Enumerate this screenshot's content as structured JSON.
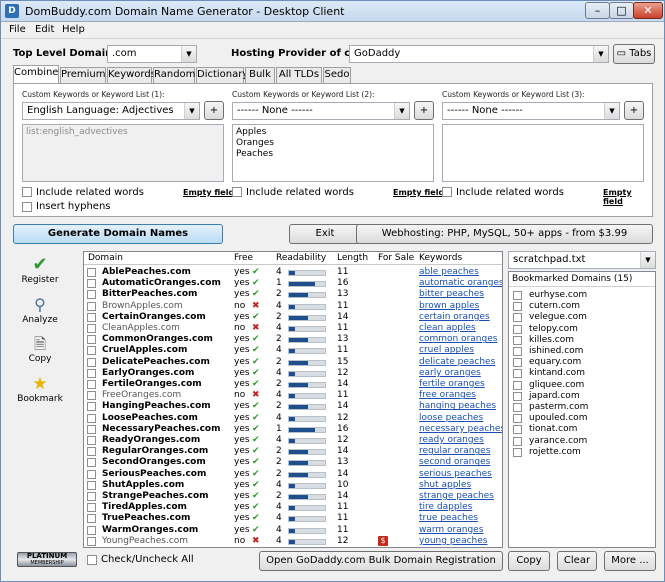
{
  "window": {
    "title": "DomBuddy.com Domain Name Generator - Desktop Client",
    "min": "–",
    "max": "□",
    "close": "✕"
  },
  "menu": [
    "File",
    "Edit",
    "Help"
  ],
  "top": {
    "tld_label": "Top Level Domain:",
    "tld_value": ".com",
    "hosting_label": "Hosting Provider of choice:",
    "hosting_value": "GoDaddy",
    "tabs_button": "Tabs"
  },
  "tabs": [
    "Combine",
    "Premium",
    "Keywords",
    "Random",
    "Dictionary",
    "Bulk",
    "All TLDs",
    "Sedo"
  ],
  "combine": {
    "col1": {
      "header": "Custom Keywords or Keyword List (1):",
      "select": "English Language: Adjectives",
      "list_text": "list:english_advectives",
      "include_related": "Include related words",
      "empty_field": "Empty field",
      "insert_hyphens": "Insert hyphens"
    },
    "col2": {
      "header": "Custom Keywords or Keyword List (2):",
      "select": "------ None ------",
      "lines": [
        "Apples",
        "Oranges",
        "Peaches"
      ],
      "include_related": "Include related words",
      "empty_field": "Empty field"
    },
    "col3": {
      "header": "Custom Keywords or Keyword List (3):",
      "select": "------ None ------",
      "include_related": "Include related words",
      "empty_field": "Empty field"
    },
    "add": "+"
  },
  "actions": {
    "generate": "Generate Domain Names",
    "exit": "Exit",
    "webhosting": "Webhosting: PHP, MySQL, 50+ apps - from $3.99"
  },
  "side": {
    "register": "Register",
    "analyze": "Analyze",
    "copy": "Copy",
    "bookmark": "Bookmark"
  },
  "grid": {
    "headers": {
      "domain": "Domain",
      "free": "Free",
      "readability": "Readability",
      "length": "Length",
      "forsale": "For Sale",
      "keywords": "Keywords"
    },
    "rows": [
      {
        "domain": "AblePeaches.com",
        "free": "yes",
        "read": 4,
        "length": 11,
        "forsale": "",
        "kw": "able peaches"
      },
      {
        "domain": "AutomaticOranges.com",
        "free": "yes",
        "read": 1,
        "length": 16,
        "forsale": "",
        "kw": "automatic oranges"
      },
      {
        "domain": "BitterPeaches.com",
        "free": "yes",
        "read": 2,
        "length": 13,
        "forsale": "",
        "kw": "bitter peaches"
      },
      {
        "domain": "BrownApples.com",
        "free": "no",
        "read": 4,
        "length": 11,
        "forsale": "",
        "kw": "brown apples"
      },
      {
        "domain": "CertainOranges.com",
        "free": "yes",
        "read": 2,
        "length": 14,
        "forsale": "",
        "kw": "certain oranges"
      },
      {
        "domain": "CleanApples.com",
        "free": "no",
        "read": 4,
        "length": 11,
        "forsale": "",
        "kw": "clean apples"
      },
      {
        "domain": "CommonOranges.com",
        "free": "yes",
        "read": 2,
        "length": 13,
        "forsale": "",
        "kw": "common oranges"
      },
      {
        "domain": "CruelApples.com",
        "free": "yes",
        "read": 4,
        "length": 11,
        "forsale": "",
        "kw": "cruel apples"
      },
      {
        "domain": "DelicatePeaches.com",
        "free": "yes",
        "read": 2,
        "length": 15,
        "forsale": "",
        "kw": "delicate peaches"
      },
      {
        "domain": "EarlyOranges.com",
        "free": "yes",
        "read": 4,
        "length": 12,
        "forsale": "",
        "kw": "early oranges"
      },
      {
        "domain": "FertileOranges.com",
        "free": "yes",
        "read": 2,
        "length": 14,
        "forsale": "",
        "kw": "fertile oranges"
      },
      {
        "domain": "FreeOranges.com",
        "free": "no",
        "read": 4,
        "length": 11,
        "forsale": "",
        "kw": "free oranges"
      },
      {
        "domain": "HangingPeaches.com",
        "free": "yes",
        "read": 2,
        "length": 14,
        "forsale": "",
        "kw": "hanging peaches"
      },
      {
        "domain": "LoosePeaches.com",
        "free": "yes",
        "read": 4,
        "length": 12,
        "forsale": "",
        "kw": "loose peaches"
      },
      {
        "domain": "NecessaryPeaches.com",
        "free": "yes",
        "read": 1,
        "length": 16,
        "forsale": "",
        "kw": "necessary peaches"
      },
      {
        "domain": "ReadyOranges.com",
        "free": "yes",
        "read": 4,
        "length": 12,
        "forsale": "",
        "kw": "ready oranges"
      },
      {
        "domain": "RegularOranges.com",
        "free": "yes",
        "read": 2,
        "length": 14,
        "forsale": "",
        "kw": "regular oranges"
      },
      {
        "domain": "SecondOranges.com",
        "free": "yes",
        "read": 2,
        "length": 13,
        "forsale": "",
        "kw": "second oranges"
      },
      {
        "domain": "SeriousPeaches.com",
        "free": "yes",
        "read": 2,
        "length": 14,
        "forsale": "",
        "kw": "serious peaches"
      },
      {
        "domain": "ShutApples.com",
        "free": "yes",
        "read": 4,
        "length": 10,
        "forsale": "",
        "kw": "shut apples"
      },
      {
        "domain": "StrangePeaches.com",
        "free": "yes",
        "read": 2,
        "length": 14,
        "forsale": "",
        "kw": "strange peaches"
      },
      {
        "domain": "TiredApples.com",
        "free": "yes",
        "read": 4,
        "length": 11,
        "forsale": "",
        "kw": "tire dapples"
      },
      {
        "domain": "TruePeaches.com",
        "free": "yes",
        "read": 4,
        "length": 11,
        "forsale": "",
        "kw": "true peaches"
      },
      {
        "domain": "WarmOranges.com",
        "free": "yes",
        "read": 4,
        "length": 11,
        "forsale": "",
        "kw": "warm oranges"
      },
      {
        "domain": "YoungPeaches.com",
        "free": "no",
        "read": 4,
        "length": 12,
        "forsale": "$",
        "kw": "young peaches"
      }
    ]
  },
  "checkall": "Check/Uncheck All",
  "bulk_button": "Open GoDaddy.com Bulk Domain Registration",
  "scratchpad": {
    "select": "scratchpad.txt",
    "header": "Bookmarked Domains (15)",
    "items": [
      "eurhyse.com",
      "cutern.com",
      "velegue.com",
      "telopy.com",
      "killes.com",
      "ishined.com",
      "equary.com",
      "kintand.com",
      "gliquee.com",
      "japard.com",
      "pasterm.com",
      "upouled.com",
      "tionat.com",
      "yarance.com",
      "rojette.com"
    ]
  },
  "bottom": {
    "copy": "Copy",
    "clear": "Clear",
    "more": "More ..."
  },
  "badge": {
    "line1": "PLATINUM",
    "line2": "MEMBERSHIP"
  }
}
